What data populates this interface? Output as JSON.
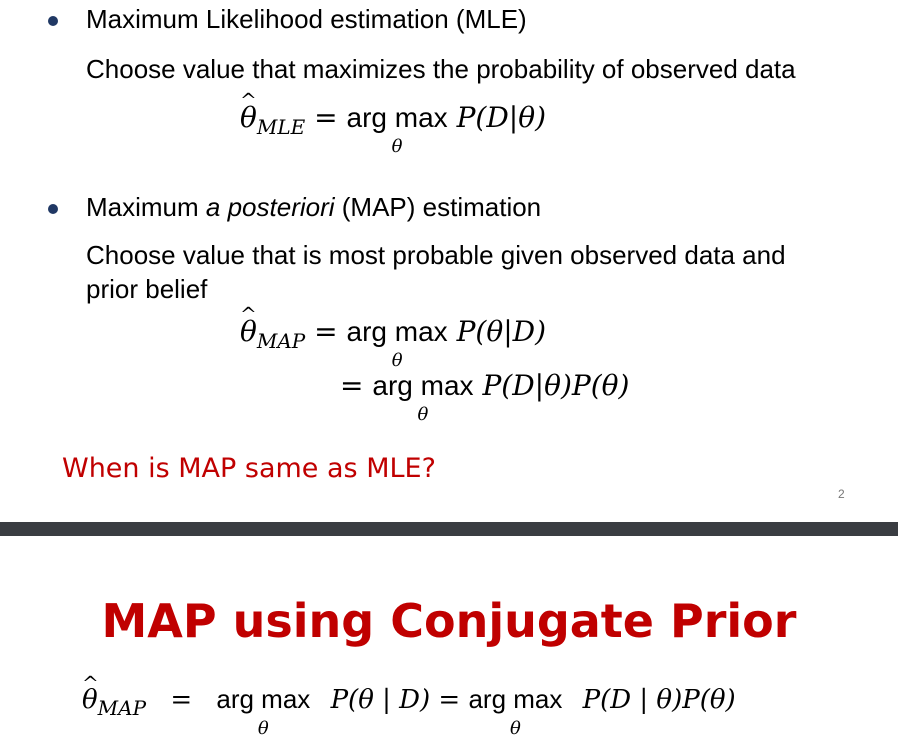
{
  "slide1": {
    "bullet1": {
      "title": "Maximum Likelihood estimation (MLE)",
      "desc": "Choose value that maximizes the probability of observed data"
    },
    "mle_eq": {
      "lhs": "θ",
      "lhs_sub": "MLE",
      "eq": "=",
      "argmax": "arg max",
      "under": "θ",
      "rhs": "P(D|θ)"
    },
    "bullet2": {
      "title_pre": "Maximum ",
      "title_em": "a posteriori",
      "title_post": " (MAP) estimation",
      "desc_line1": "Choose value that is most probable given observed data and",
      "desc_line2": "prior belief"
    },
    "map_eq": {
      "lhs": "θ",
      "lhs_sub": "MAP",
      "eq": "=",
      "argmax": "arg max",
      "under": "θ",
      "rhs1": "P(θ|D)",
      "rhs2": "P(D|θ)P(θ)"
    },
    "question": "When is MAP same as MLE?",
    "page_number": "2"
  },
  "slide2": {
    "title": "MAP using Conjugate Prior",
    "eq": {
      "lhs": "θ",
      "lhs_sub": "MAP",
      "eq": "=",
      "argmax": "arg max",
      "under": "θ",
      "rhs1": "P(θ | D) =",
      "rhs2": "P(D | θ)P(θ)"
    }
  }
}
